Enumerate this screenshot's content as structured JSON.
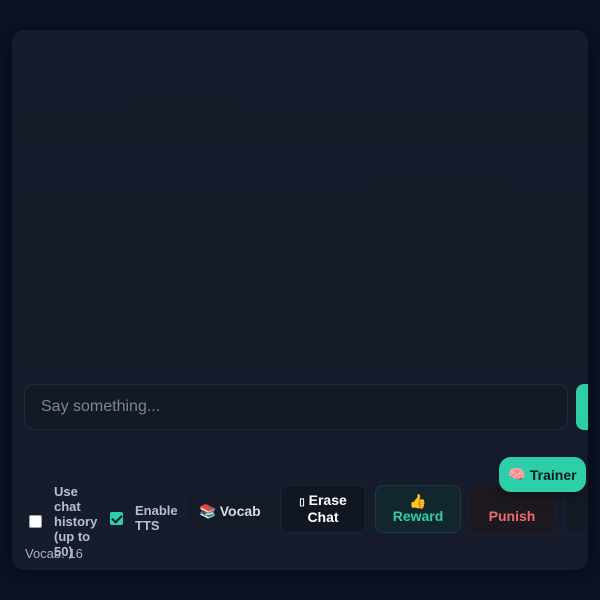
{
  "chat": {
    "input_placeholder": "Say something...",
    "input_value": ""
  },
  "options": {
    "use_history_label_lines": [
      "Use",
      "chat",
      "history",
      "(up to",
      "50)"
    ],
    "use_history_checked": false,
    "enable_tts_label_lines": [
      "Enable",
      "TTS"
    ],
    "enable_tts_checked": true
  },
  "buttons": {
    "vocab": {
      "icon": "books-icon",
      "glyph": "📚",
      "label": "Vocab"
    },
    "erase": {
      "icon": "missing-glyph-icon",
      "glyph": "▯",
      "label_lines": [
        "Erase",
        "Chat"
      ]
    },
    "reward": {
      "icon": "thumbs-up-icon",
      "glyph": "👍",
      "label": "Reward"
    },
    "punish": {
      "icon": "hidden-icon",
      "label": "Punish"
    },
    "trainer": {
      "icon": "brain-icon",
      "glyph": "🧠",
      "label": "Trainer"
    }
  },
  "status": {
    "vocab_count": "Vocab: 16"
  },
  "colors": {
    "accent": "#2ccfa8",
    "punish": "#f06a6a",
    "background": "#0a1224",
    "card": "#161c2b"
  }
}
